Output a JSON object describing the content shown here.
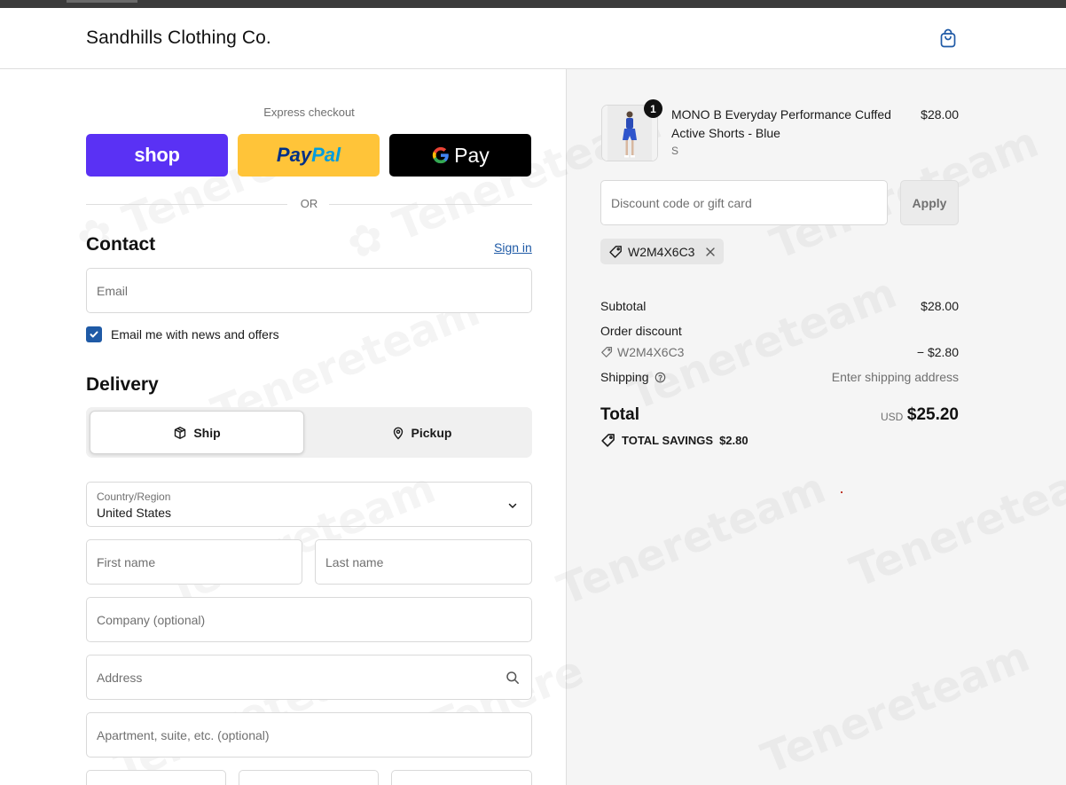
{
  "header": {
    "store_name": "Sandhills Clothing Co."
  },
  "express": {
    "label": "Express checkout",
    "shop_label": "shop",
    "paypal_part1": "Pay",
    "paypal_part2": "Pal",
    "gpay_label": "Pay",
    "or_label": "OR"
  },
  "contact": {
    "title": "Contact",
    "sign_in": "Sign in",
    "email_placeholder": "Email",
    "newsletter_label": "Email me with news and offers",
    "newsletter_checked": true
  },
  "delivery": {
    "title": "Delivery",
    "ship_label": "Ship",
    "pickup_label": "Pickup",
    "country_label": "Country/Region",
    "country_value": "United States",
    "first_name_placeholder": "First name",
    "last_name_placeholder": "Last name",
    "company_placeholder": "Company (optional)",
    "address_placeholder": "Address",
    "apartment_placeholder": "Apartment, suite, etc. (optional)"
  },
  "cart": {
    "item": {
      "name": "MONO B Everyday Performance Cuffed Active Shorts - Blue",
      "variant": "S",
      "price": "$28.00",
      "quantity": "1"
    },
    "discount_placeholder": "Discount code or gift card",
    "apply_label": "Apply",
    "applied_code": "W2M4X6C3"
  },
  "summary": {
    "subtotal_label": "Subtotal",
    "subtotal_value": "$28.00",
    "order_discount_label": "Order discount",
    "discount_code": "W2M4X6C3",
    "discount_value": "− $2.80",
    "shipping_label": "Shipping",
    "shipping_value": "Enter shipping address",
    "total_label": "Total",
    "total_currency": "USD",
    "total_value": "$25.20",
    "savings_label": "TOTAL SAVINGS",
    "savings_value": "$2.80"
  },
  "colors": {
    "shop_purple": "#5a31f4",
    "paypal_yellow": "#ffc439",
    "link_blue": "#1f5aa6"
  }
}
